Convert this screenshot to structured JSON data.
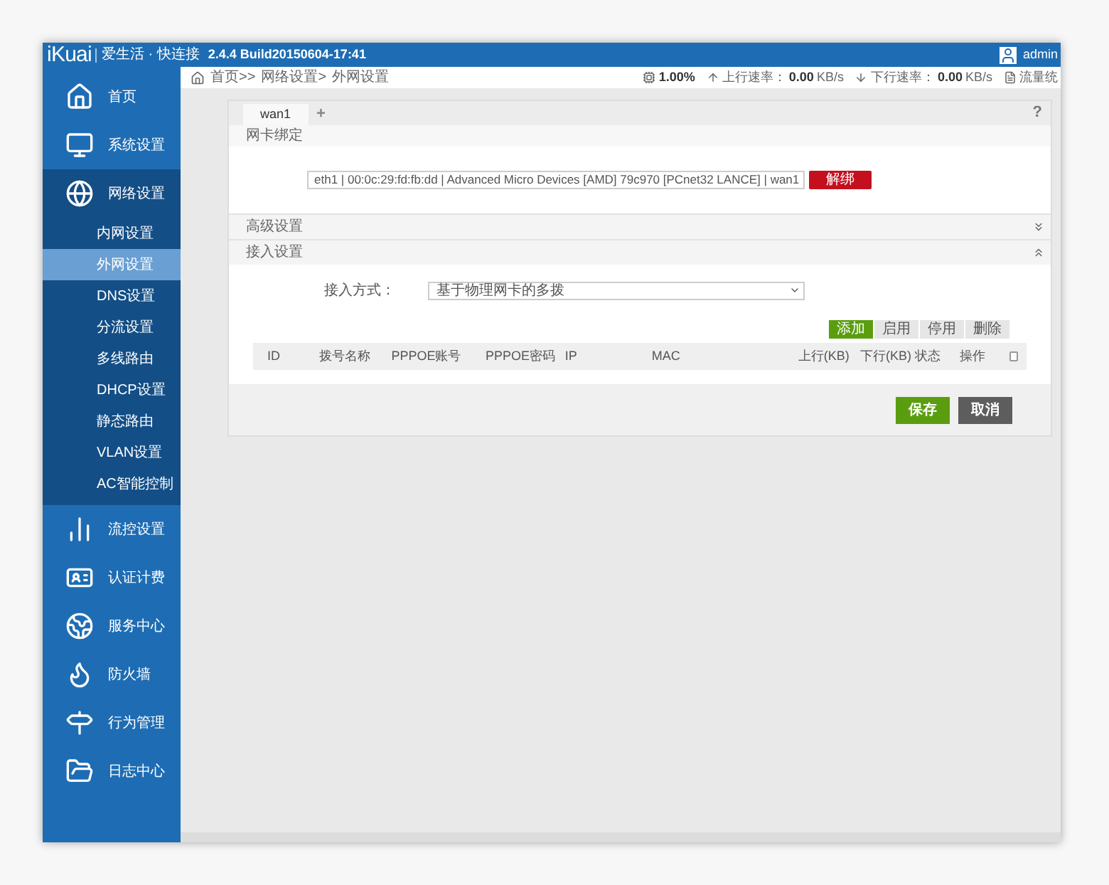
{
  "header": {
    "logo": "iKuai",
    "slogan": "爱生活 · 快连接",
    "version": "2.4.4 Build20150604-17:41",
    "user": "admin"
  },
  "breadcrumb": [
    "首页>>",
    "网络设置>",
    "外网设置"
  ],
  "status": [
    {
      "value": "1.00%"
    },
    {
      "label": "上行速率：",
      "value": "0.00",
      "unit": "KB/s"
    },
    {
      "label": "下行速率：",
      "value": "0.00",
      "unit": "KB/s"
    },
    {
      "label": "流量统"
    }
  ],
  "sidebar": [
    {
      "label": "首页",
      "selected": false,
      "expanded": false
    },
    {
      "label": "系统设置",
      "selected": false,
      "expanded": false
    },
    {
      "label": "网络设置",
      "selected": false,
      "expanded": true,
      "children": [
        {
          "label": "内网设置",
          "selected": false
        },
        {
          "label": "外网设置",
          "selected": true
        },
        {
          "label": "DNS设置",
          "selected": false
        },
        {
          "label": "分流设置",
          "selected": false
        },
        {
          "label": "多线路由",
          "selected": false
        },
        {
          "label": "DHCP设置",
          "selected": false
        },
        {
          "label": "静态路由",
          "selected": false
        },
        {
          "label": "VLAN设置",
          "selected": false
        },
        {
          "label": "AC智能控制",
          "selected": false
        }
      ]
    },
    {
      "label": "流控设置",
      "selected": false,
      "expanded": false
    },
    {
      "label": "认证计费",
      "selected": false,
      "expanded": false
    },
    {
      "label": "服务中心",
      "selected": false,
      "expanded": false
    },
    {
      "label": "防火墙",
      "selected": false,
      "expanded": false
    },
    {
      "label": "行为管理",
      "selected": false,
      "expanded": false
    },
    {
      "label": "日志中心",
      "selected": false,
      "expanded": false
    }
  ],
  "tabs": [
    {
      "label": "wan1",
      "selected": true
    }
  ],
  "add_tab": "+",
  "help": "?",
  "nic_section": {
    "title": "网卡绑定",
    "select_value": "eth1 | 00:0c:29:fd:fb:dd | Advanced Micro Devices [AMD] 79c970 [PCnet32 LANCE] | wan1",
    "unbind_button": "解绑"
  },
  "advanced_section": {
    "title": "高级设置",
    "expanded": false
  },
  "access_section": {
    "title": "接入设置",
    "expanded": true,
    "field_label": "接入方式：",
    "field_value": "基于物理网卡的多拨",
    "buttons": [
      {
        "label": "添加",
        "kind": "primary"
      },
      {
        "label": "启用",
        "kind": "default"
      },
      {
        "label": "停用",
        "kind": "default"
      },
      {
        "label": "删除",
        "kind": "default"
      }
    ],
    "columns": [
      "ID",
      "拨号名称",
      "PPPOE账号",
      "PPPOE密码",
      "IP",
      "MAC",
      "上行(KB)",
      "下行(KB)",
      "状态",
      "操作"
    ],
    "select_all_checked": false
  },
  "footer_buttons": [
    {
      "label": "保存",
      "kind": "primary"
    },
    {
      "label": "取消",
      "kind": "secondary"
    }
  ]
}
